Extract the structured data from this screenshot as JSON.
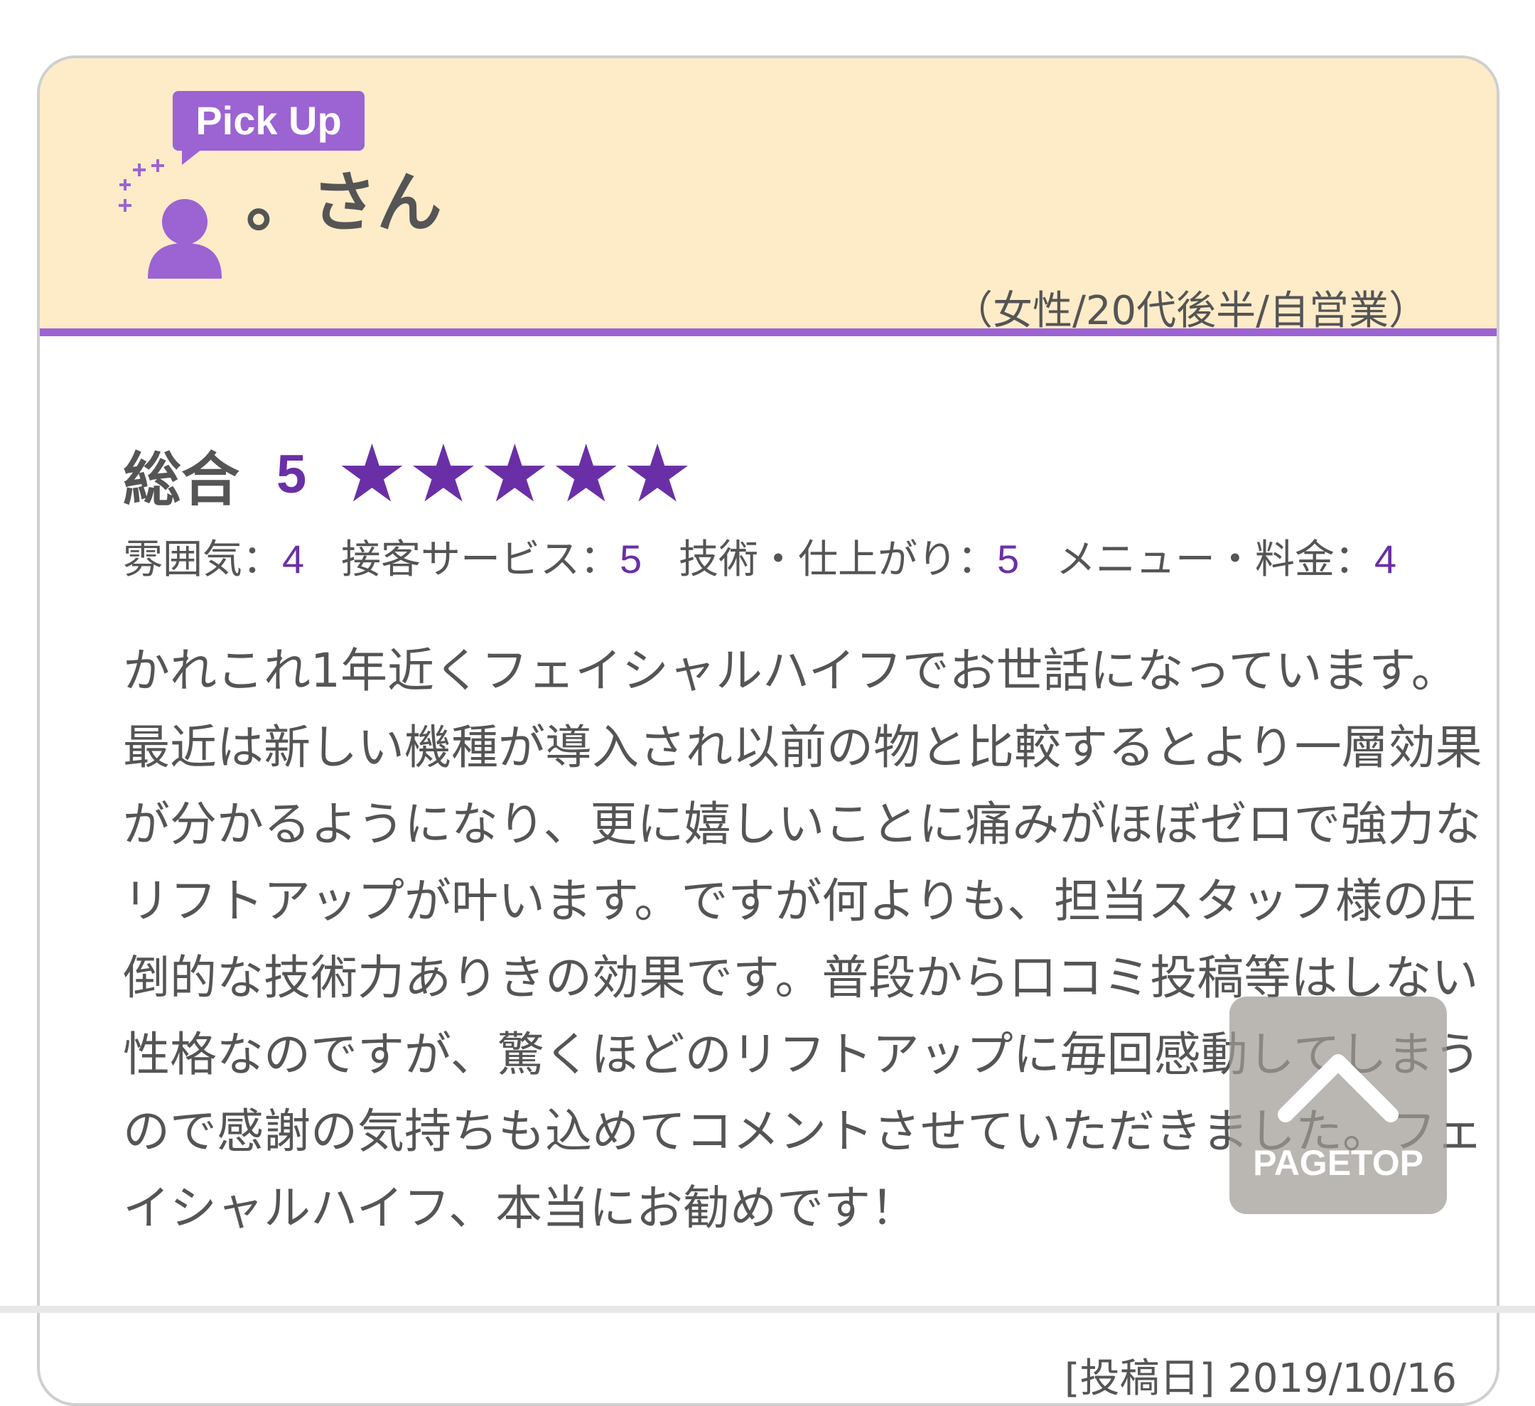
{
  "review": {
    "badge_label": "Pick Up",
    "username": "。さん",
    "demographic": "（女性/20代後半/自営業）",
    "overall": {
      "label": "総合",
      "score": "5",
      "stars_filled": 5,
      "stars_total": 5
    },
    "sub_ratings": [
      {
        "label": "雰囲気：",
        "value": "4"
      },
      {
        "label": "接客サービス：",
        "value": "5"
      },
      {
        "label": "技術・仕上がり：",
        "value": "5"
      },
      {
        "label": "メニュー・料金：",
        "value": "4"
      }
    ],
    "body": "かれこれ1年近くフェイシャルハイフでお世話になっています。最近は新しい機種が導入され以前の物と比較するとより一層効果が分かるようになり、更に嬉しいことに痛みがほぼゼロで強力なリフトアップが叶います。ですが何よりも、担当スタッフ様の圧倒的な技術力ありきの効果です。普段から口コミ投稿等はしない性格なのですが、驚くほどのリフトアップに毎回感動してしまうので感謝の気持ちも込めてコメントさせていただきました。フェイシャルハイフ、本当にお勧めです！",
    "post_date": "[投稿日] 2019/10/16"
  },
  "pagetop": {
    "label": "PAGETOP",
    "icon": "chevron-up-icon"
  },
  "colors": {
    "accent": "#6a2fa6",
    "badge": "#9c63d3",
    "header_bg": "#feecc8",
    "text": "#555555"
  }
}
